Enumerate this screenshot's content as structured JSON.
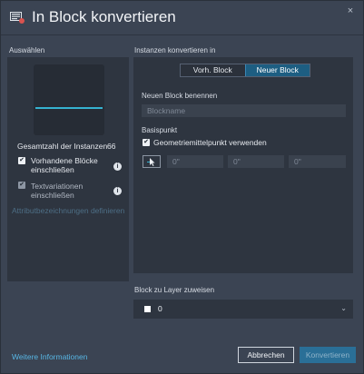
{
  "dialog": {
    "title": "In Block konvertieren",
    "close_label": "×"
  },
  "left": {
    "section_label": "Auswählen",
    "instance_count_label": "Gesamtzahl der Instanzen",
    "instance_count_value": "66",
    "existing_blocks_label": "Vorhandene Blöcke einschließen",
    "existing_blocks_checked": true,
    "text_variations_label": "Textvariationen einschließen",
    "text_variations_checked": true,
    "define_attributes_link": "Attributbezeichnungen definieren"
  },
  "right": {
    "section_label": "Instanzen konvertieren in",
    "tabs": [
      {
        "label": "Vorh. Block",
        "active": false
      },
      {
        "label": "Neuer Block",
        "active": true
      }
    ],
    "name_label": "Neuen Block benennen",
    "name_placeholder": "Blockname",
    "basepoint_label": "Basispunkt",
    "centroid_label": "Geometriemittelpunkt verwenden",
    "centroid_checked": true,
    "coords": [
      "0\"",
      "0\"",
      "0\""
    ]
  },
  "layer": {
    "section_label": "Block zu Layer zuweisen",
    "selected_value": "0",
    "swatch_color": "#ffffff"
  },
  "footer": {
    "more_info_link": "Weitere Informationen",
    "cancel_label": "Abbrechen",
    "convert_label": "Konvertieren"
  },
  "colors": {
    "accent": "#1d5e82",
    "link": "#58b6e4",
    "preview_line": "#35b2d0"
  }
}
